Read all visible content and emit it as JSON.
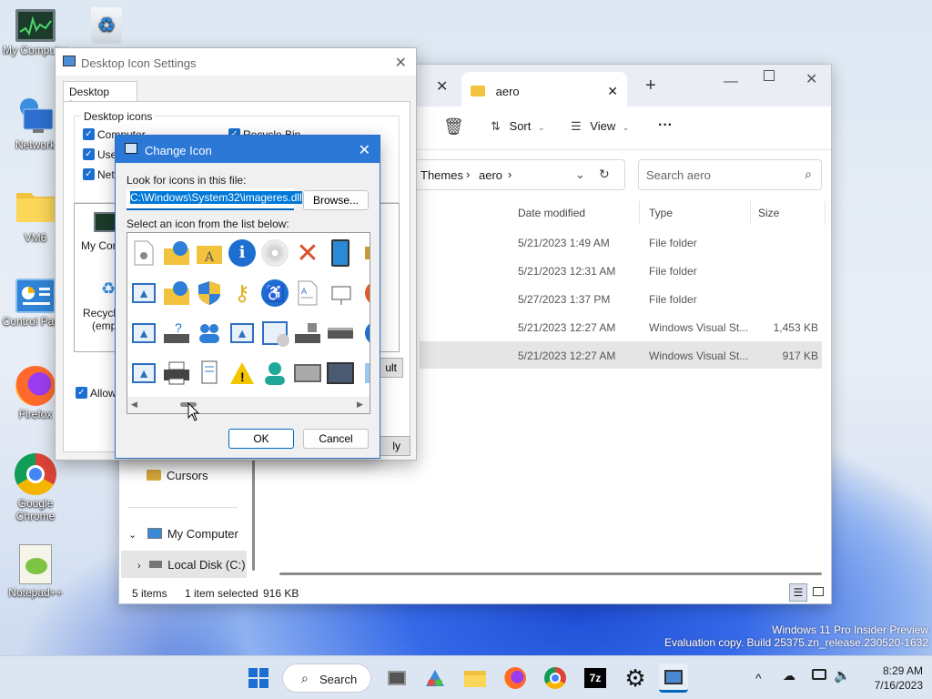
{
  "desktop": {
    "icons": [
      {
        "label": "My Computer"
      },
      {
        "label": "Recycle Bin"
      },
      {
        "label": "Network"
      },
      {
        "label": "VM6"
      },
      {
        "label": "Control Panel"
      },
      {
        "label": "Firefox"
      },
      {
        "label": "Google Chrome"
      },
      {
        "label": "Notepad++"
      }
    ],
    "watermark_line1": "Windows 11 Pro Insider Preview",
    "watermark_line2": "Evaluation copy. Build 25375.zn_release.230520-1632"
  },
  "explorer": {
    "tab_label": "aero",
    "new_tab": "+",
    "sort_label": "Sort",
    "view_label": "View",
    "more": "···",
    "breadcrumb": [
      "Themes",
      "aero"
    ],
    "search_placeholder": "Search aero",
    "columns": [
      "Date modified",
      "Type",
      "Size"
    ],
    "rows": [
      {
        "date": "5/21/2023 1:49 AM",
        "type": "File folder",
        "size": ""
      },
      {
        "date": "5/21/2023 12:31 AM",
        "type": "File folder",
        "size": ""
      },
      {
        "date": "5/27/2023 1:37 PM",
        "type": "File folder",
        "size": ""
      },
      {
        "date": "5/21/2023 12:27 AM",
        "type": "Windows Visual St...",
        "size": "1,453 KB"
      },
      {
        "date": "5/21/2023 12:27 AM",
        "type": "Windows Visual St...",
        "size": "917 KB"
      }
    ],
    "nav": {
      "cursors": "Cursors",
      "my_computer": "My Computer",
      "local_disk": "Local Disk (C:)"
    },
    "status": {
      "items": "5 items",
      "selected": "1 item selected",
      "size": "916 KB"
    }
  },
  "desktop_icon_settings": {
    "title": "Desktop Icon Settings",
    "tab": "Desktop Icons",
    "group": "Desktop icons",
    "checks": [
      "Computer",
      "User",
      "Netw",
      "Recycle Bin"
    ],
    "preview": [
      "My Comp",
      "Recycle",
      "(empt"
    ],
    "allow": "Allow t",
    "default_btn": "ult",
    "apply_btn": "ly"
  },
  "change_icon": {
    "title": "Change Icon",
    "look_label": "Look for icons in this file:",
    "path_value": "C:\\Windows\\System32\\imageres.dll",
    "browse": "Browse...",
    "select_label": "Select an icon from the list below:",
    "ok": "OK",
    "cancel": "Cancel"
  },
  "taskbar": {
    "search": "Search",
    "time": "8:29 AM",
    "date": "7/16/2023",
    "chevron": "^"
  },
  "colors": {
    "accent": "#0067c0",
    "selection": "#cce8ff",
    "selected_row": "#e5e5e5"
  }
}
